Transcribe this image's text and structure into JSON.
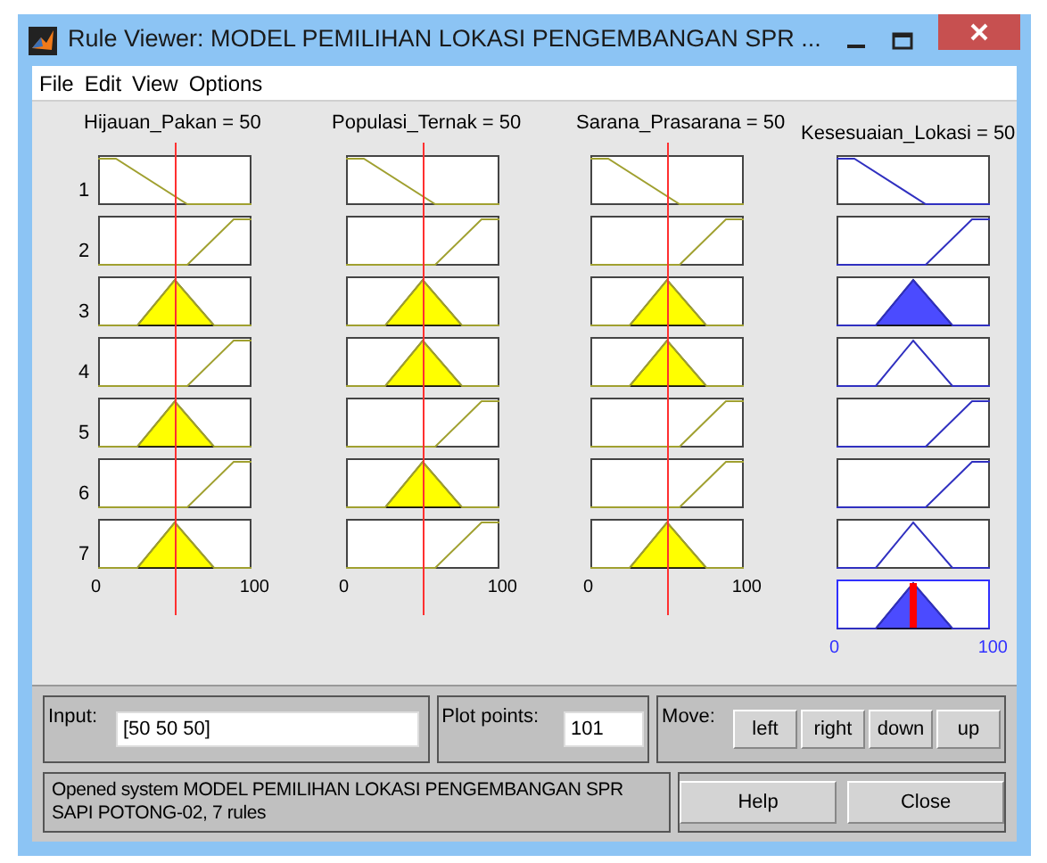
{
  "window": {
    "title": "Rule Viewer: MODEL PEMILIHAN LOKASI PENGEMBANGAN SPR ..."
  },
  "menu": [
    "File",
    "Edit",
    "View",
    "Options"
  ],
  "inputs": [
    {
      "label": "Hijauan_Pakan = 50",
      "ticks": [
        "0",
        "100"
      ],
      "rules": [
        {
          "kind": "low"
        },
        {
          "kind": "high"
        },
        {
          "kind": "mid"
        },
        {
          "kind": "high"
        },
        {
          "kind": "mid"
        },
        {
          "kind": "high"
        },
        {
          "kind": "mid"
        }
      ]
    },
    {
      "label": "Populasi_Ternak = 50",
      "ticks": [
        "0",
        "100"
      ],
      "rules": [
        {
          "kind": "low"
        },
        {
          "kind": "high"
        },
        {
          "kind": "mid"
        },
        {
          "kind": "mid"
        },
        {
          "kind": "high"
        },
        {
          "kind": "mid"
        },
        {
          "kind": "high"
        }
      ]
    },
    {
      "label": "Sarana_Prasarana = 50",
      "ticks": [
        "0",
        "100"
      ],
      "rules": [
        {
          "kind": "low"
        },
        {
          "kind": "high"
        },
        {
          "kind": "mid"
        },
        {
          "kind": "mid"
        },
        {
          "kind": "high"
        },
        {
          "kind": "high"
        },
        {
          "kind": "mid"
        }
      ]
    }
  ],
  "rule_numbers": [
    "1",
    "2",
    "3",
    "4",
    "5",
    "6",
    "7"
  ],
  "output": {
    "label": "Kesesuaian_Lokasi = 50",
    "ticks": [
      "0",
      "100"
    ],
    "rules": [
      {
        "kind": "low",
        "filled": false
      },
      {
        "kind": "high",
        "filled": false
      },
      {
        "kind": "mid",
        "filled": true
      },
      {
        "kind": "mid",
        "filled": false
      },
      {
        "kind": "high",
        "filled": false
      },
      {
        "kind": "high",
        "filled": false
      },
      {
        "kind": "mid",
        "filled": false
      }
    ]
  },
  "input_field": {
    "label": "Input:",
    "value": "[50 50 50]"
  },
  "plot_points": {
    "label": "Plot points:",
    "value": "101"
  },
  "move": {
    "label": "Move:",
    "buttons": [
      "left",
      "right",
      "down",
      "up"
    ]
  },
  "status": "Opened system MODEL PEMILIHAN LOKASI PENGEMBANGAN SPR SAPI POTONG-02, 7 rules",
  "buttons": [
    "Help",
    "Close"
  ]
}
